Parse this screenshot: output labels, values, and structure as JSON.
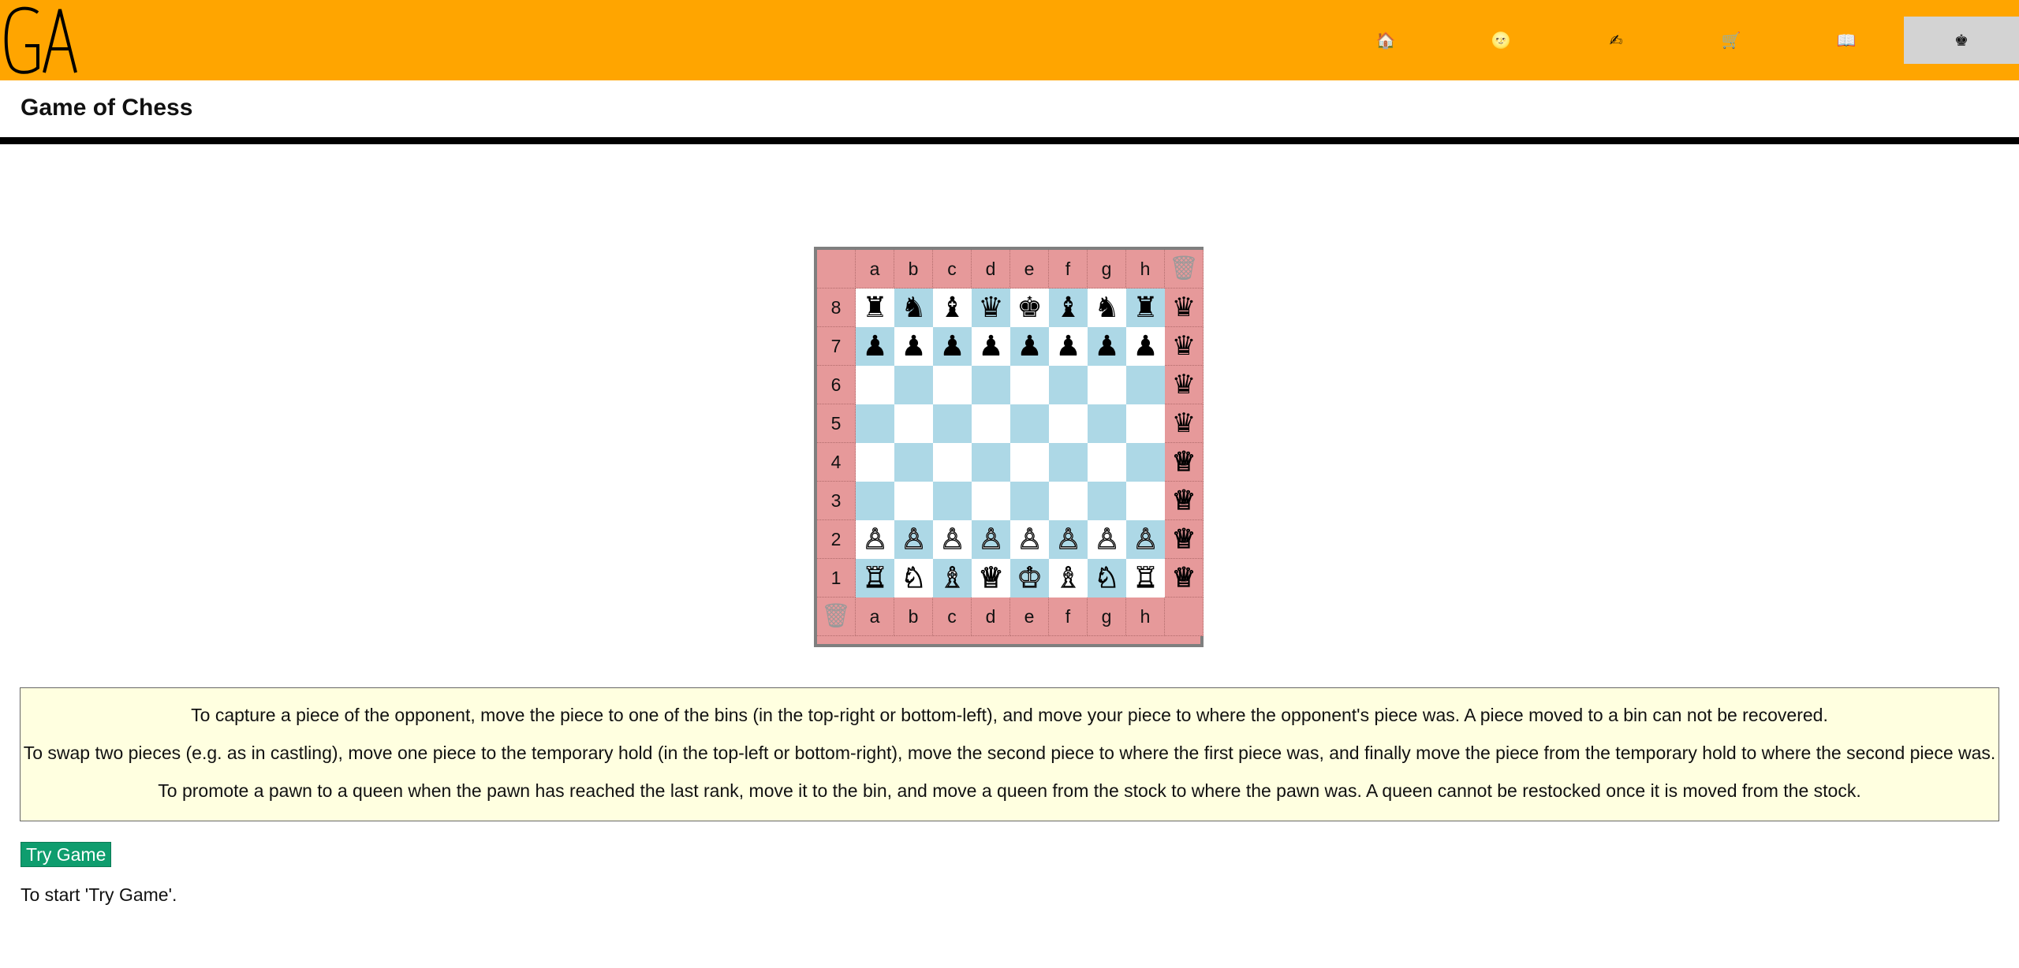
{
  "header": {
    "logo_text": "GA",
    "nav": [
      {
        "icon": "🏠",
        "icon_name": "home-icon"
      },
      {
        "icon": "🌝",
        "icon_name": "moon-face-icon"
      },
      {
        "icon": "✍",
        "icon_name": "writing-hand-icon"
      },
      {
        "icon": "🛒",
        "icon_name": "cart-icon"
      },
      {
        "icon": "📖",
        "icon_name": "book-icon"
      },
      {
        "icon": "♚",
        "icon_name": "chess-icon",
        "active": true
      }
    ]
  },
  "page_title": "Game of Chess",
  "board": {
    "files": [
      "a",
      "b",
      "c",
      "d",
      "e",
      "f",
      "g",
      "h"
    ],
    "ranks": [
      "8",
      "7",
      "6",
      "5",
      "4",
      "3",
      "2",
      "1"
    ],
    "rows": [
      [
        "♜",
        "♞",
        "♝",
        "♛",
        "♚",
        "♝",
        "♞",
        "♜"
      ],
      [
        "♟",
        "♟",
        "♟",
        "♟",
        "♟",
        "♟",
        "♟",
        "♟"
      ],
      [
        "",
        "",
        "",
        "",
        "",
        "",
        "",
        ""
      ],
      [
        "",
        "",
        "",
        "",
        "",
        "",
        "",
        ""
      ],
      [
        "",
        "",
        "",
        "",
        "",
        "",
        "",
        ""
      ],
      [
        "",
        "",
        "",
        "",
        "",
        "",
        "",
        ""
      ],
      [
        "♙",
        "♙",
        "♙",
        "♙",
        "♙",
        "♙",
        "♙",
        "♙"
      ],
      [
        "♖",
        "♘",
        "♗",
        "♕",
        "♔",
        "♗",
        "♘",
        "♖"
      ]
    ],
    "bin_icon": "🗑",
    "stock": [
      "♛",
      "♛",
      "♛",
      "♛",
      "♕",
      "♕",
      "♕",
      "♕"
    ],
    "colors": {
      "light": "#ffffff",
      "dark": "#add8e6",
      "edge": "#e6999a",
      "border": "#7f7f7f"
    }
  },
  "rules": [
    "To capture a piece of the opponent, move the piece to one of the bins (in the top-right or bottom-left), and move your piece to where the opponent's piece was. A piece moved to a bin can not be recovered.",
    "To swap two pieces (e.g. as in castling), move one piece to the temporary hold (in the top-left or bottom-right), move the second piece to where the first piece was, and finally move the piece from the temporary hold to where the second piece was.",
    "To promote a pawn to a queen when the pawn has reached the last rank, move it to the bin, and move a queen from the stock to where the pawn was. A queen cannot be restocked once it is moved from the stock."
  ],
  "try_button_label": "Try Game",
  "hint_text": "To start 'Try Game'.",
  "colors": {
    "header": "#ffa500",
    "button": "#0f9d6e",
    "rules_bg": "#ffffe0"
  }
}
